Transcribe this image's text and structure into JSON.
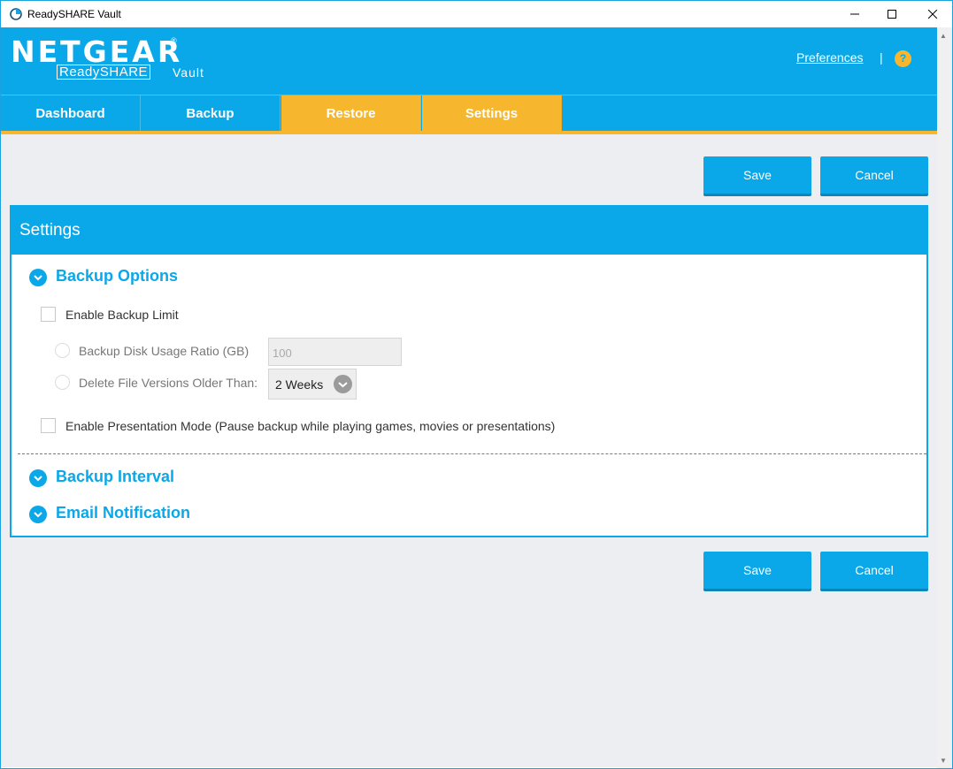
{
  "window": {
    "title": "ReadySHARE Vault"
  },
  "header": {
    "logo": "NETGEAR",
    "logo_reg": "®",
    "logo_sub_boxed": "ReadySHARE",
    "logo_sub_tail": "Vault",
    "preferences": "Preferences",
    "separator": "|",
    "help": "?"
  },
  "tabs": [
    {
      "label": "Dashboard"
    },
    {
      "label": "Backup"
    },
    {
      "label": "Restore"
    },
    {
      "label": "Settings"
    }
  ],
  "actions": {
    "save": "Save",
    "cancel": "Cancel"
  },
  "settings": {
    "title": "Settings",
    "backup_options": {
      "title": "Backup Options",
      "enable_backup_limit": "Enable Backup Limit",
      "disk_usage_label": "Backup Disk Usage Ratio (GB)",
      "disk_usage_value": "100",
      "delete_versions_label": "Delete File Versions Older Than:",
      "delete_versions_value": "2 Weeks",
      "presentation_mode": "Enable Presentation Mode (Pause backup while playing games, movies or presentations)"
    },
    "backup_interval": {
      "title": "Backup Interval"
    },
    "email_notification": {
      "title": "Email Notification"
    }
  },
  "colors": {
    "primary": "#0aa8e8",
    "accent": "#f6b72e",
    "background": "#eceef1"
  }
}
